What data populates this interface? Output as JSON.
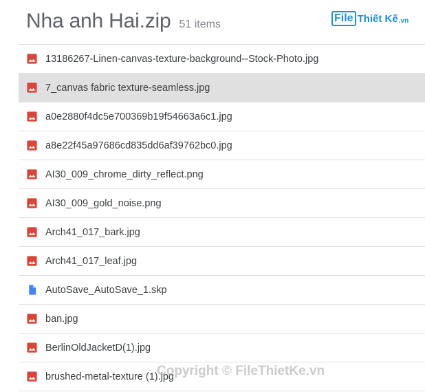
{
  "header": {
    "title": "Nha anh Hai.zip",
    "count": "51 items"
  },
  "logo": {
    "file": "File",
    "text": "Thiết Kế",
    "suffix": ".vn"
  },
  "colors": {
    "image_icon": "#db4437",
    "doc_icon": "#4285f4",
    "selected_row": "#e0e0e0"
  },
  "files": [
    {
      "name": "13186267-Linen-canvas-texture-background--Stock-Photo.jpg",
      "icon": "image-file-icon"
    },
    {
      "name": "7_canvas fabric texture-seamless.jpg",
      "icon": "image-file-icon",
      "selected": true
    },
    {
      "name": "a0e2880f4dc5e700369b19f54663a6c1.jpg",
      "icon": "image-file-icon"
    },
    {
      "name": "a8e22f45a97686cd835dd6af39762bc0.jpg",
      "icon": "image-file-icon"
    },
    {
      "name": "AI30_009_chrome_dirty_reflect.png",
      "icon": "image-file-icon"
    },
    {
      "name": "AI30_009_gold_noise.png",
      "icon": "image-file-icon"
    },
    {
      "name": "Arch41_017_bark.jpg",
      "icon": "image-file-icon"
    },
    {
      "name": "Arch41_017_leaf.jpg",
      "icon": "image-file-icon"
    },
    {
      "name": "AutoSave_AutoSave_1.skp",
      "icon": "document-file-icon"
    },
    {
      "name": "ban.jpg",
      "icon": "image-file-icon"
    },
    {
      "name": "BerlinOldJacketD(1).jpg",
      "icon": "image-file-icon"
    },
    {
      "name": "brushed-metal-texture (1).jpg",
      "icon": "image-file-icon"
    }
  ],
  "watermark": "Copyright © FileThietKe.vn"
}
